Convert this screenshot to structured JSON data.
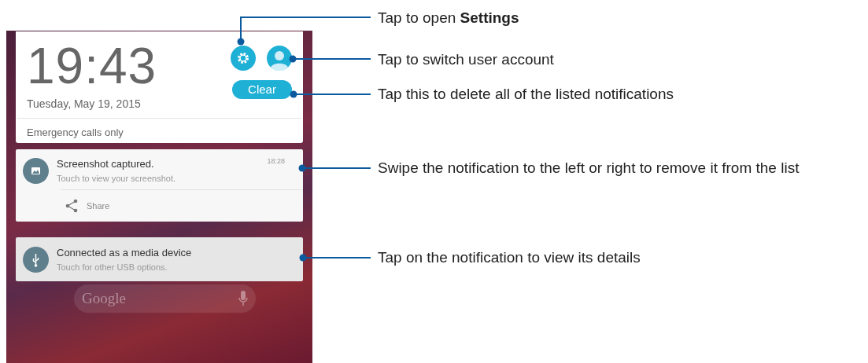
{
  "lock_card": {
    "time": "19:43",
    "date": "Tuesday, May 19, 2015",
    "clear_button": "Clear",
    "status": "Emergency calls only"
  },
  "notifications": [
    {
      "kind": "image",
      "title": "Screenshot captured.",
      "text": "Touch to view your screenshot.",
      "time": "18:28",
      "action": "Share"
    },
    {
      "kind": "usb",
      "title": "Connected as a media device",
      "text": "Touch for other USB options."
    }
  ],
  "search_bar": {
    "placeholder": "Google"
  },
  "callouts": [
    "Tap to open **Settings**",
    "Tap to switch user account",
    "Tap this to delete all of the listed notifications",
    "Swipe the notification to the left or right to remove it from the list",
    "Tap on the notification to view its details"
  ]
}
